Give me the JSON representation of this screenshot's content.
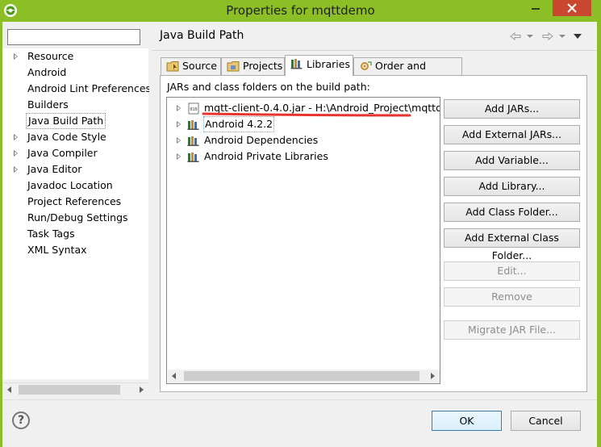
{
  "window": {
    "title": "Properties for mqttdemo"
  },
  "filter": {
    "value": "",
    "placeholder": ""
  },
  "nav": {
    "items": [
      {
        "label": "Resource",
        "expandable": true
      },
      {
        "label": "Android",
        "expandable": false
      },
      {
        "label": "Android Lint Preferences",
        "expandable": false
      },
      {
        "label": "Builders",
        "expandable": false
      },
      {
        "label": "Java Build Path",
        "expandable": false,
        "selected": true
      },
      {
        "label": "Java Code Style",
        "expandable": true
      },
      {
        "label": "Java Compiler",
        "expandable": true
      },
      {
        "label": "Java Editor",
        "expandable": true
      },
      {
        "label": "Javadoc Location",
        "expandable": false
      },
      {
        "label": "Project References",
        "expandable": false
      },
      {
        "label": "Run/Debug Settings",
        "expandable": false
      },
      {
        "label": "Task Tags",
        "expandable": false
      },
      {
        "label": "XML Syntax",
        "expandable": false
      }
    ]
  },
  "page": {
    "title": "Java Build Path",
    "tabs": [
      {
        "label": "Source",
        "icon": "source-folder-icon"
      },
      {
        "label": "Projects",
        "icon": "projects-icon"
      },
      {
        "label": "Libraries",
        "icon": "libraries-icon",
        "active": true
      },
      {
        "label": "Order and Export",
        "icon": "order-export-icon"
      }
    ],
    "libraries_label": "JARs and class folders on the build path:",
    "libraries": [
      {
        "label": "mqtt-client-0.4.0.jar - H:\\Android_Project\\mqttdem",
        "icon": "jar-file-icon"
      },
      {
        "label": "Android 4.2.2",
        "icon": "library-icon",
        "selected": true
      },
      {
        "label": "Android Dependencies",
        "icon": "library-icon"
      },
      {
        "label": "Android Private Libraries",
        "icon": "library-icon"
      }
    ],
    "buttons": [
      {
        "label": "Add JARs...",
        "enabled": true
      },
      {
        "label": "Add External JARs...",
        "enabled": true
      },
      {
        "label": "Add Variable...",
        "enabled": true
      },
      {
        "label": "Add Library...",
        "enabled": true
      },
      {
        "label": "Add Class Folder...",
        "enabled": true
      },
      {
        "label": "Add External Class Folder...",
        "enabled": true
      },
      {
        "label": "Edit...",
        "enabled": false
      },
      {
        "label": "Remove",
        "enabled": false
      },
      {
        "label": "Migrate JAR File...",
        "enabled": false
      }
    ]
  },
  "dialog": {
    "ok_label": "OK",
    "cancel_label": "Cancel",
    "help_glyph": "?"
  },
  "colors": {
    "title_bar": "#8cbf26",
    "close_button": "#c9462f",
    "annotation_underline": "#e8332f"
  }
}
